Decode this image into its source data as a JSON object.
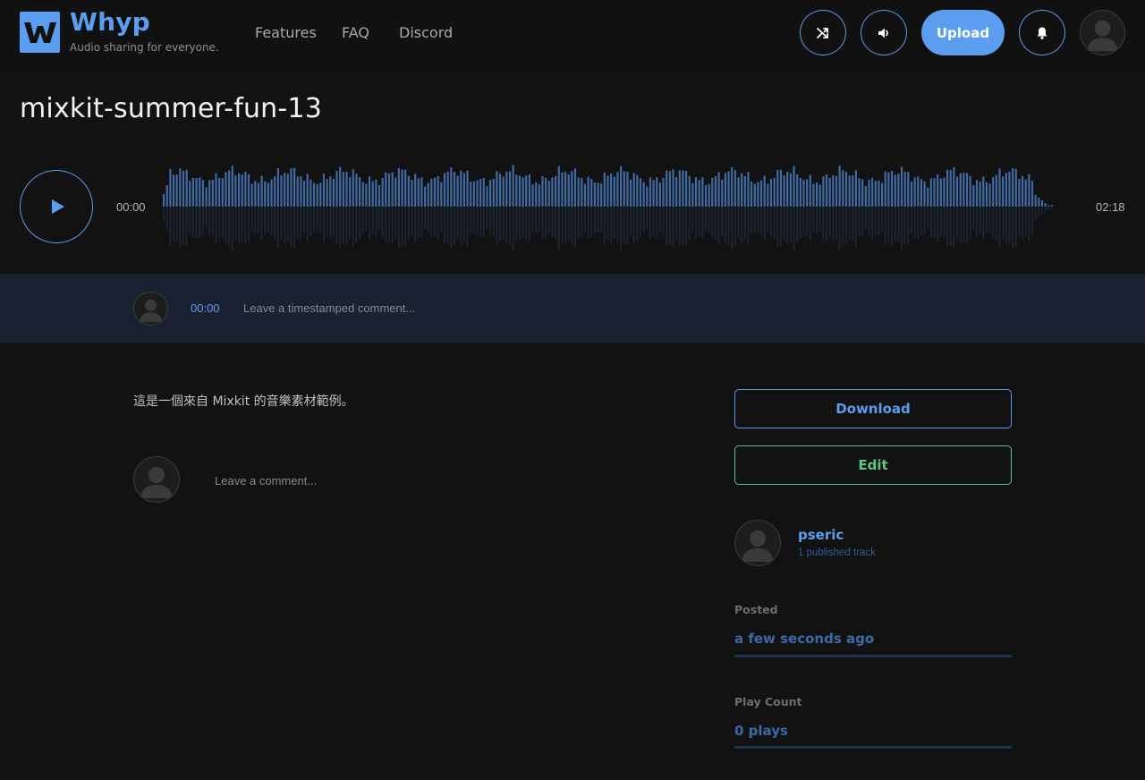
{
  "header": {
    "brand": "Whyp",
    "tagline": "Audio sharing for everyone.",
    "nav": [
      "Features",
      "FAQ",
      "Discord"
    ],
    "upload_label": "Upload",
    "icons": [
      "shuffle-icon",
      "volume-icon",
      "bell-icon",
      "user-avatar"
    ]
  },
  "track": {
    "title": "mixkit-summer-fun-13",
    "current_time": "00:00",
    "duration": "02:18",
    "progress": 0
  },
  "timestamped_comment": {
    "time": "00:00",
    "placeholder": "Leave a timestamped comment..."
  },
  "description": "這是一個來自 Mixkit 的音樂素材範例。",
  "comment": {
    "placeholder": "Leave a comment..."
  },
  "actions": {
    "download_label": "Download",
    "edit_label": "Edit"
  },
  "uploader": {
    "name": "pseric",
    "tracks": "1 published track"
  },
  "stats": {
    "posted_label": "Posted",
    "posted_value": "a few seconds ago",
    "plays_label": "Play Count",
    "plays_value": "0 plays"
  },
  "colors": {
    "accent": "#5b9ef0",
    "edit": "#5fc48b",
    "background": "#121212",
    "comment_bar": "#1a2130"
  }
}
